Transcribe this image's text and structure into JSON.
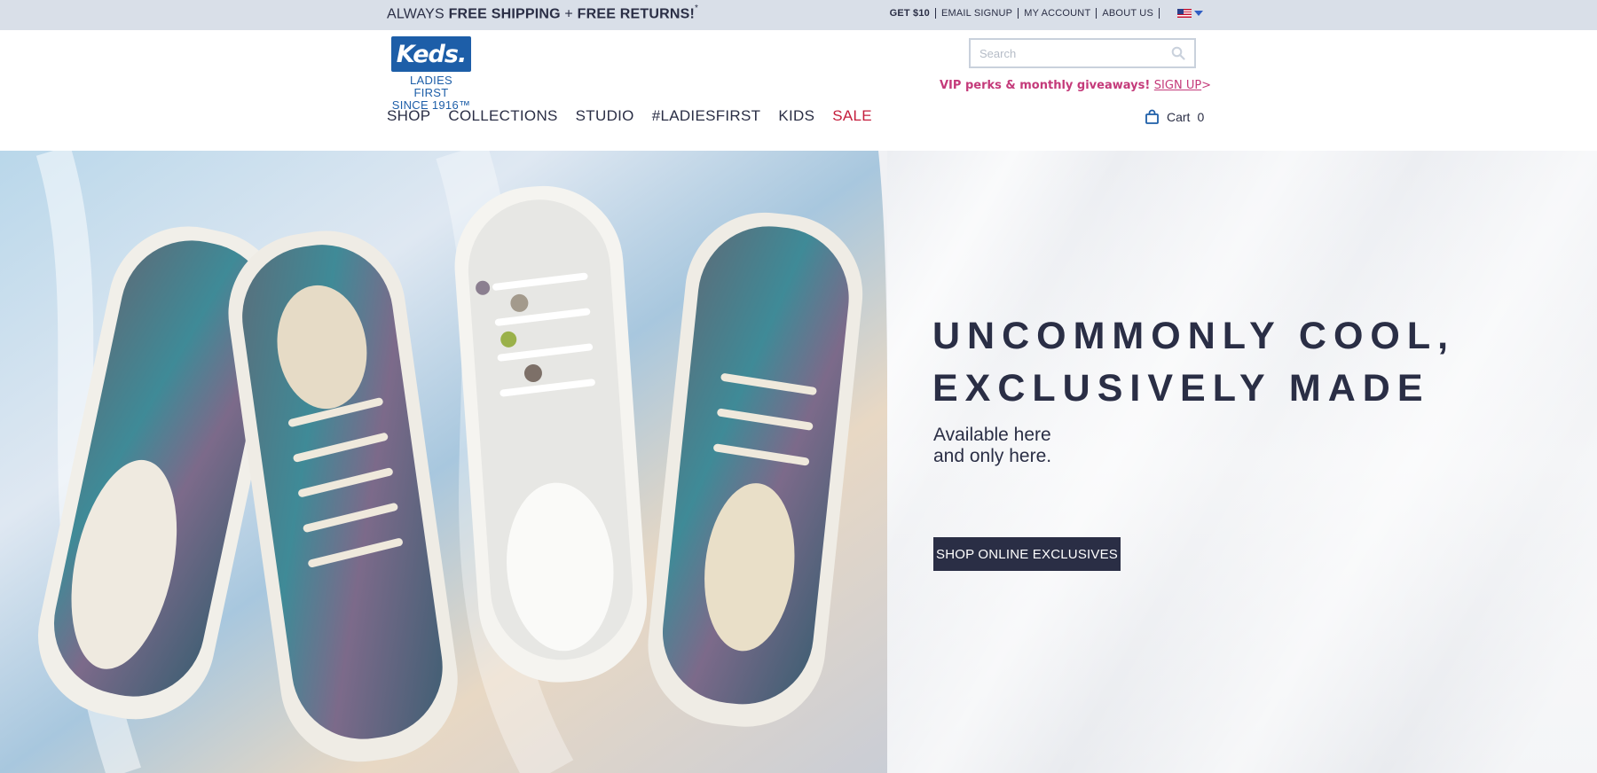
{
  "topbar": {
    "promo_prefix": "ALWAYS ",
    "promo_bold1": "FREE SHIPPING",
    "promo_plus": " + ",
    "promo_bold2": "FREE RETURNS!",
    "promo_star": "*",
    "links": [
      "GET $10",
      "EMAIL SIGNUP",
      "MY ACCOUNT",
      "ABOUT US"
    ],
    "flag_icon": "us-flag-icon",
    "caret_icon": "chevron-down-icon"
  },
  "header": {
    "logo": {
      "word": "Keds",
      "dot": ".",
      "tagline1": "LADIES FIRST",
      "tagline2": "SINCE 1916™"
    },
    "search": {
      "placeholder": "Search",
      "value": "",
      "icon": "search-icon"
    },
    "vip": {
      "text": "VIP perks & monthly giveaways! ",
      "link": "SIGN UP",
      "arrow": ">"
    },
    "nav": [
      "SHOP",
      "COLLECTIONS",
      "STUDIO",
      "#LADIESFIRST",
      "KIDS",
      "SALE"
    ],
    "cart": {
      "label": "Cart",
      "count": "0",
      "icon": "shopping-bag-icon"
    }
  },
  "hero": {
    "headline_line1": "UNCOMMONLY COOL,",
    "headline_line2": "EXCLUSIVELY MADE",
    "sub_line1": "Available here",
    "sub_line2": "and only here.",
    "cta": "SHOP ONLINE EXCLUSIVES"
  },
  "colors": {
    "brand_blue": "#1d5ea8",
    "navy": "#2a2e45",
    "sale_red": "#c41d3c",
    "vip_pink": "#c43a7a",
    "topbar_bg": "#d9dfe8"
  }
}
